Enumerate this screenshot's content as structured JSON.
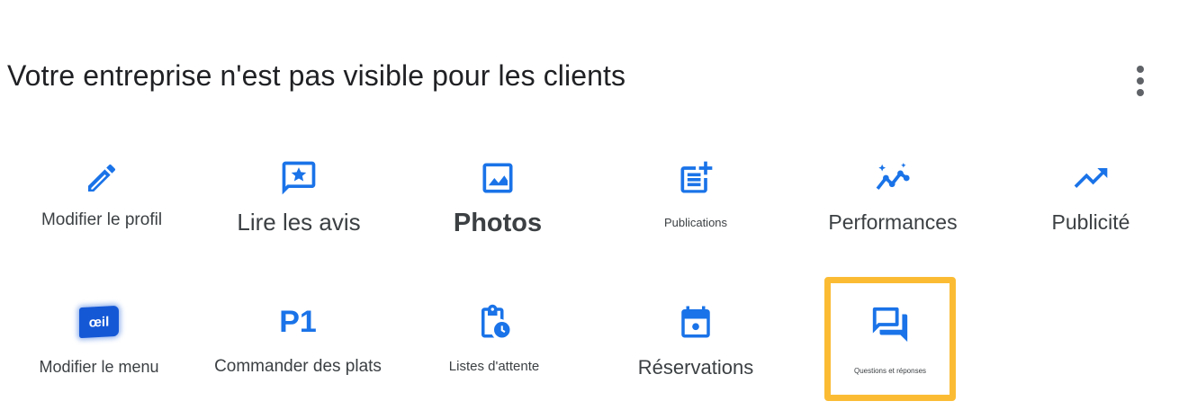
{
  "header": {
    "title": "Votre entreprise n'est pas visible pour les clients",
    "more_icon": "more-vert-icon"
  },
  "colors": {
    "accent": "#1a73e8",
    "highlight": "#fbbc34",
    "text": "#3c4043"
  },
  "actions": [
    {
      "label": "Modifier le profil",
      "icon": "edit-pencil-icon"
    },
    {
      "label": "Lire les avis",
      "icon": "review-star-icon"
    },
    {
      "label": "Photos",
      "icon": "photo-icon"
    },
    {
      "label": "Publications",
      "icon": "post-add-icon"
    },
    {
      "label": "Performances",
      "icon": "performance-sparkle-icon"
    },
    {
      "label": "Publicité",
      "icon": "trending-up-icon"
    },
    {
      "label": "Modifier le menu",
      "icon": "menu-oeil-icon",
      "icon_text": "œil"
    },
    {
      "label": "Commander des plats",
      "icon": "p1-icon",
      "icon_text": "P1"
    },
    {
      "label": "Listes d'attente",
      "icon": "waitlist-clock-icon"
    },
    {
      "label": "Réservations",
      "icon": "calendar-icon"
    },
    {
      "label": "Questions et réponses",
      "icon": "question-answer-icon",
      "highlighted": true
    }
  ]
}
